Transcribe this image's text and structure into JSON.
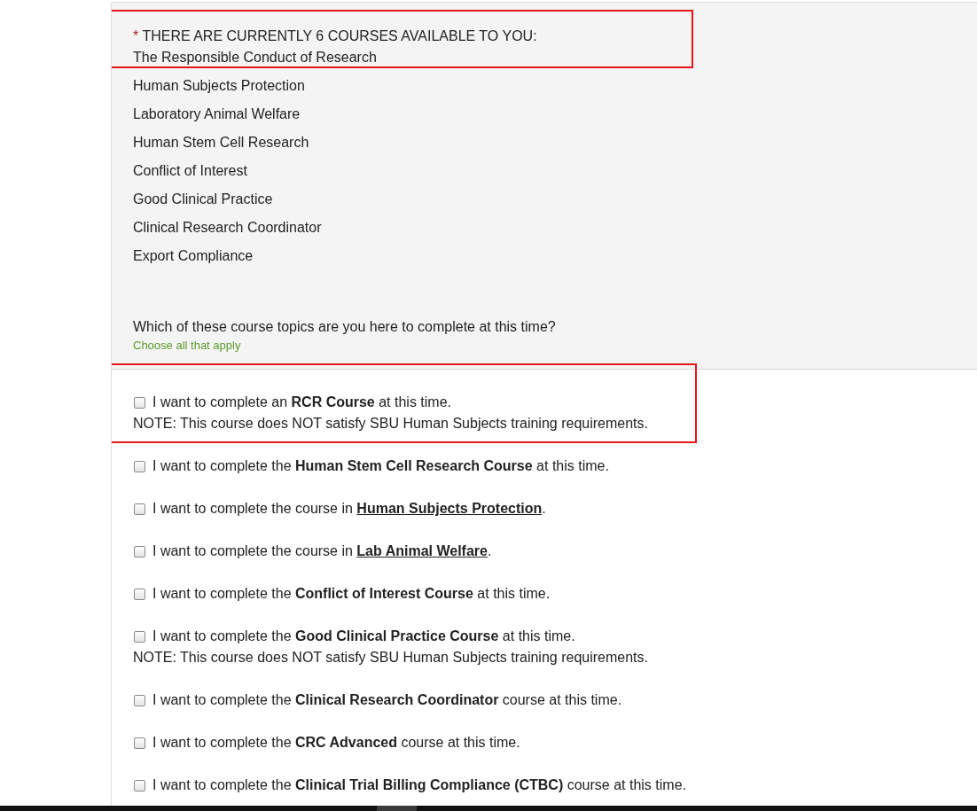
{
  "intro": {
    "marker": "*",
    "heading": "THERE ARE CURRENTLY 6 COURSES AVAILABLE TO YOU:",
    "highlighted": true
  },
  "courses": [
    {
      "label": "The Responsible Conduct of Research"
    },
    {
      "label": "Human Subjects Protection"
    },
    {
      "label": "Laboratory Animal Welfare"
    },
    {
      "label": "Human Stem Cell Research"
    },
    {
      "label": "Conflict of Interest"
    },
    {
      "label": "Good Clinical Practice"
    },
    {
      "label": "Clinical Research Coordinator"
    },
    {
      "label": "Export Compliance"
    }
  ],
  "question": "Which of these course topics are you here to complete at this time?",
  "hint": "Choose all that apply",
  "options": [
    {
      "checked": false,
      "highlighted": true,
      "segments": [
        {
          "kind": "plain",
          "text": "I want to complete an "
        },
        {
          "kind": "bold",
          "text": "RCR Course"
        },
        {
          "kind": "plain",
          "text": " at this time."
        }
      ],
      "note": "NOTE: This course does NOT satisfy SBU Human Subjects training requirements."
    },
    {
      "checked": false,
      "highlighted": false,
      "segments": [
        {
          "kind": "plain",
          "text": "I want to complete the "
        },
        {
          "kind": "bold",
          "text": "Human Stem Cell Research Course"
        },
        {
          "kind": "plain",
          "text": " at this time."
        }
      ]
    },
    {
      "checked": false,
      "highlighted": false,
      "segments": [
        {
          "kind": "plain",
          "text": "I want to complete the course in "
        },
        {
          "kind": "link",
          "text": "Human Subjects Protection"
        },
        {
          "kind": "plain",
          "text": "."
        }
      ]
    },
    {
      "checked": false,
      "highlighted": false,
      "segments": [
        {
          "kind": "plain",
          "text": "I want to complete the course in "
        },
        {
          "kind": "link",
          "text": "Lab Animal Welfare"
        },
        {
          "kind": "plain",
          "text": "."
        }
      ]
    },
    {
      "checked": false,
      "highlighted": false,
      "segments": [
        {
          "kind": "plain",
          "text": "I want to complete the "
        },
        {
          "kind": "bold",
          "text": "Conflict of Interest Course"
        },
        {
          "kind": "plain",
          "text": " at this time."
        }
      ]
    },
    {
      "checked": false,
      "highlighted": false,
      "segments": [
        {
          "kind": "plain",
          "text": "I want to complete the "
        },
        {
          "kind": "bold",
          "text": "Good Clinical Practice Course"
        },
        {
          "kind": "plain",
          "text": " at this time."
        }
      ],
      "note": "NOTE: This course does NOT satisfy SBU Human Subjects training requirements."
    },
    {
      "checked": false,
      "highlighted": false,
      "segments": [
        {
          "kind": "plain",
          "text": "I want to complete the "
        },
        {
          "kind": "bold",
          "text": "Clinical Research Coordinator"
        },
        {
          "kind": "plain",
          "text": " course at this time."
        }
      ]
    },
    {
      "checked": false,
      "highlighted": false,
      "segments": [
        {
          "kind": "plain",
          "text": "I want to complete the "
        },
        {
          "kind": "bold",
          "text": "CRC Advanced"
        },
        {
          "kind": "plain",
          "text": " course at this time."
        }
      ]
    },
    {
      "checked": false,
      "highlighted": false,
      "segments": [
        {
          "kind": "plain",
          "text": "I want to complete the "
        },
        {
          "kind": "bold",
          "text": "Clinical Trial Billing Compliance (CTBC)"
        },
        {
          "kind": "plain",
          "text": " course at this time."
        }
      ]
    }
  ]
}
